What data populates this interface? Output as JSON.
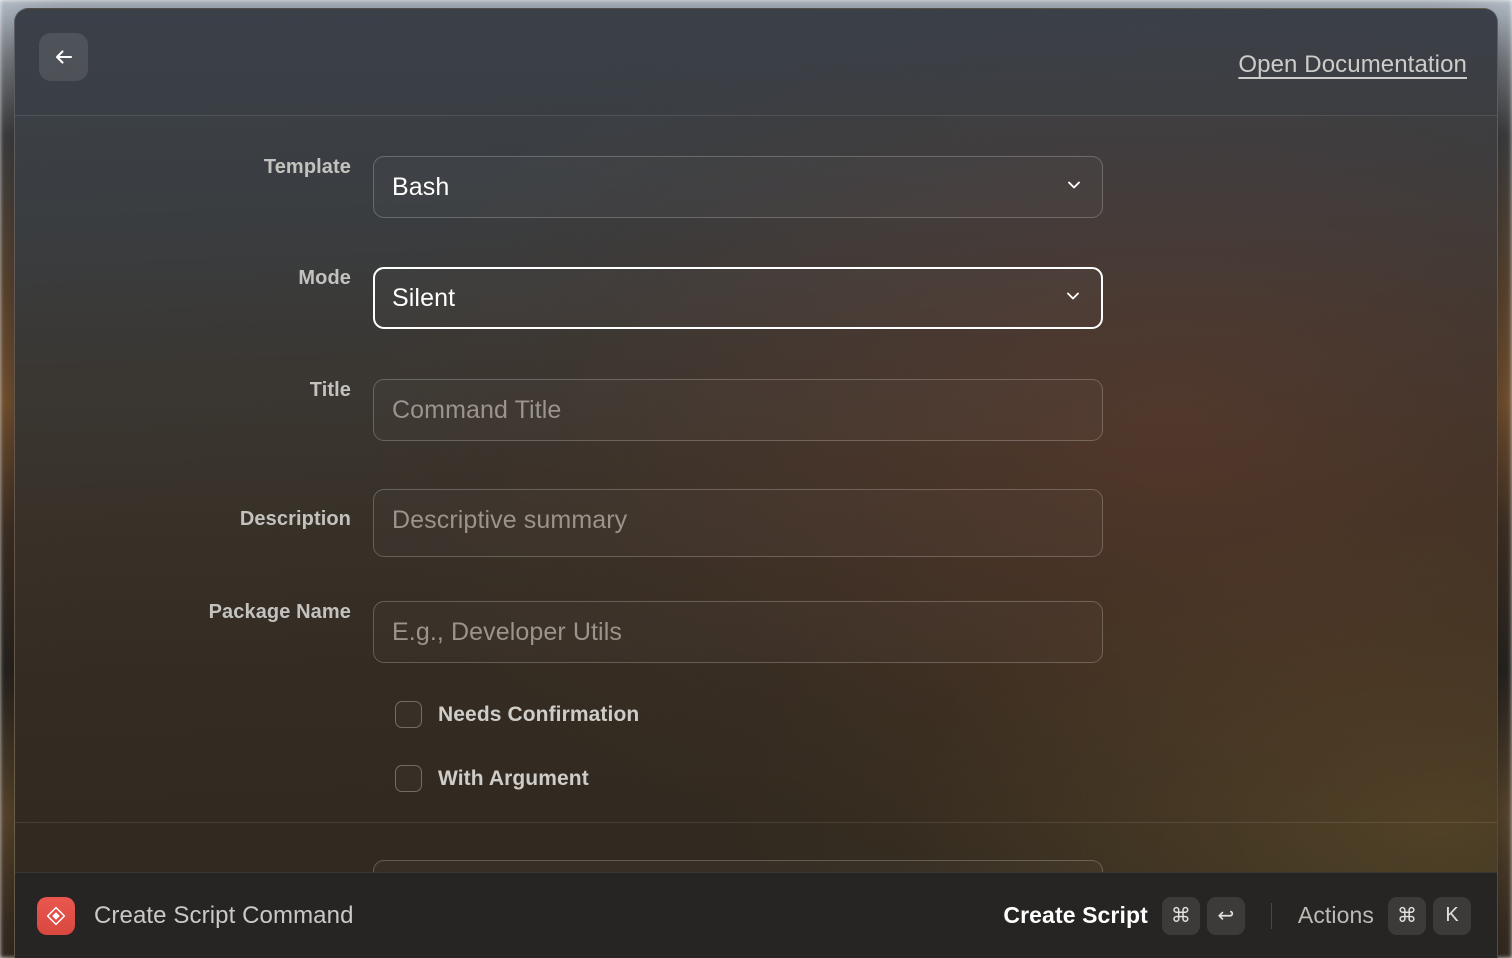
{
  "header": {
    "back_icon": "arrow-left-icon",
    "documentation_link": "Open Documentation"
  },
  "form": {
    "fields": [
      {
        "label": "Template",
        "type": "select",
        "value": "Bash",
        "focused": false,
        "icon": "chevron-down-icon"
      },
      {
        "label": "Mode",
        "type": "select",
        "value": "Silent",
        "focused": true,
        "icon": "chevron-down-icon"
      },
      {
        "label": "Title",
        "type": "input",
        "value": "",
        "placeholder": "Command Title",
        "focused": false
      },
      {
        "label": "Description",
        "type": "textarea",
        "value": "",
        "placeholder": "Descriptive summary",
        "focused": false
      },
      {
        "label": "Package Name",
        "type": "input",
        "value": "",
        "placeholder": "E.g., Developer Utils",
        "focused": false
      }
    ],
    "checkboxes": [
      {
        "label": "Needs Confirmation",
        "checked": false
      },
      {
        "label": "With Argument",
        "checked": false
      }
    ]
  },
  "footer": {
    "app_icon": "raycast-icon",
    "title": "Create Script Command",
    "primary_action": {
      "label": "Create Script",
      "keys": [
        "⌘",
        "↩"
      ]
    },
    "secondary_action": {
      "label": "Actions",
      "keys": [
        "⌘",
        "K"
      ]
    }
  },
  "colors": {
    "accent_red": "#d9483f",
    "focus_border": "#ffffff",
    "label_text": "#c3c2bf",
    "placeholder_text": "#9a948c",
    "footer_background": "#272523"
  }
}
